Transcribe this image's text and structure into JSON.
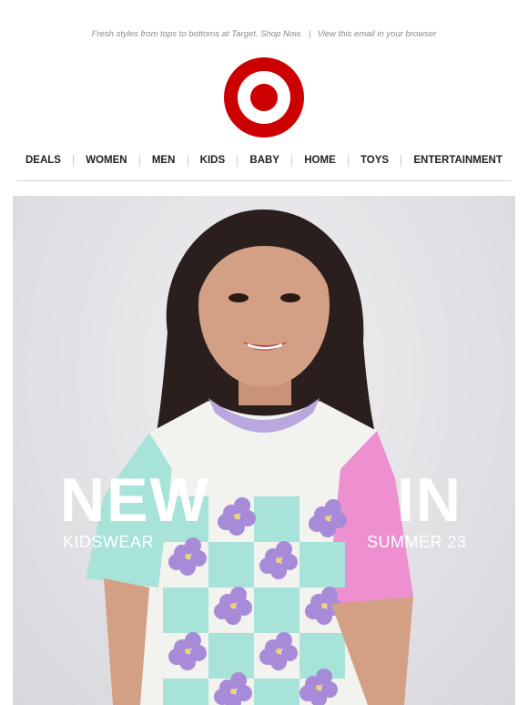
{
  "preheader": {
    "tagline": "Fresh styles from tops to bottoms at Target. Shop Now.",
    "separator": "|",
    "view_browser": "View this email in your browser"
  },
  "brand": {
    "logo_icon": "target-bullseye-logo",
    "color": "#cc0000"
  },
  "nav": {
    "items": [
      "DEALS",
      "WOMEN",
      "MEN",
      "KIDS",
      "BABY",
      "HOME",
      "TOYS",
      "ENTERTAINMENT"
    ]
  },
  "hero": {
    "title_left": "NEW",
    "title_right": "IN",
    "subtitle_left": "KIDSWEAR",
    "subtitle_right": "SUMMER 23",
    "image": "girl-in-checkered-flower-tshirt"
  }
}
